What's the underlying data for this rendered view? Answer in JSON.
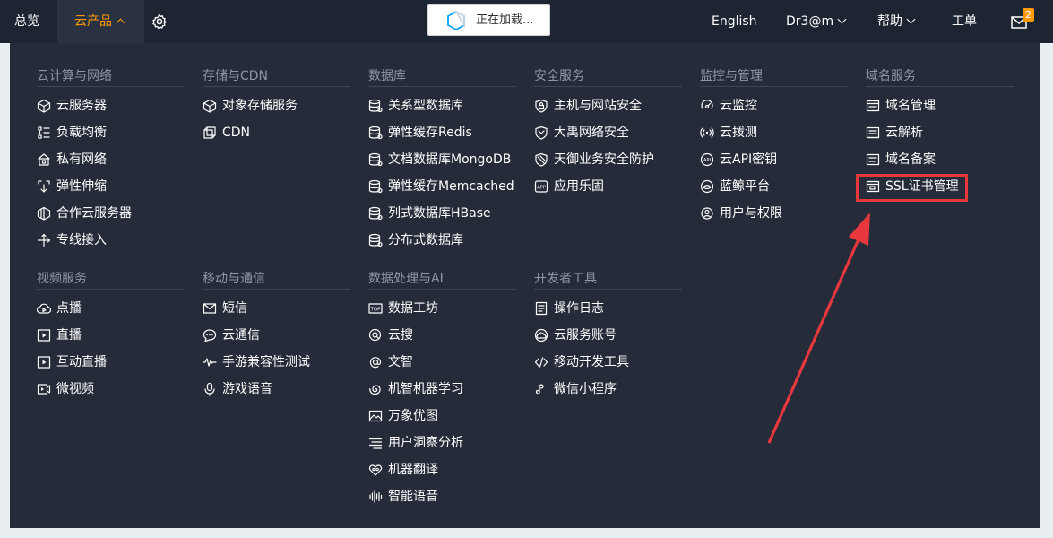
{
  "topbar": {
    "overview": "总览",
    "products": "云产品",
    "loading": "正在加载...",
    "language": "English",
    "user": "Dr3@m",
    "help": "帮助",
    "ticket": "工单",
    "mail_count": "2",
    "accent_color": "#ff9900",
    "bg_color": "#1e2532"
  },
  "menu": {
    "compute": {
      "title": "云计算与网络",
      "items": [
        {
          "label": "云服务器",
          "icon": "cube-icon"
        },
        {
          "label": "负载均衡",
          "icon": "load-balancer-icon"
        },
        {
          "label": "私有网络",
          "icon": "house-network-icon"
        },
        {
          "label": "弹性伸缩",
          "icon": "expand-icon"
        },
        {
          "label": "合作云服务器",
          "icon": "partner-cube-icon"
        },
        {
          "label": "专线接入",
          "icon": "direct-connect-icon"
        }
      ]
    },
    "storage": {
      "title": "存储与CDN",
      "items": [
        {
          "label": "对象存储服务",
          "icon": "cube-icon"
        },
        {
          "label": "CDN",
          "icon": "cdn-icon"
        }
      ]
    },
    "database": {
      "title": "数据库",
      "items": [
        {
          "label": "关系型数据库",
          "icon": "database-icon"
        },
        {
          "label": "弹性缓存Redis",
          "icon": "database-icon"
        },
        {
          "label": "文档数据库MongoDB",
          "icon": "database-icon"
        },
        {
          "label": "弹性缓存Memcached",
          "icon": "database-icon"
        },
        {
          "label": "列式数据库HBase",
          "icon": "database-icon"
        },
        {
          "label": "分布式数据库",
          "icon": "database-icon"
        }
      ]
    },
    "security": {
      "title": "安全服务",
      "items": [
        {
          "label": "主机与网站安全",
          "icon": "shield-lock-icon"
        },
        {
          "label": "大禹网络安全",
          "icon": "shield-icon"
        },
        {
          "label": "天御业务安全防护",
          "icon": "shield-striped-icon"
        },
        {
          "label": "应用乐固",
          "icon": "app-icon"
        }
      ]
    },
    "monitor": {
      "title": "监控与管理",
      "items": [
        {
          "label": "云监控",
          "icon": "monitor-icon"
        },
        {
          "label": "云拨测",
          "icon": "signal-icon"
        },
        {
          "label": "云API密钥",
          "icon": "api-key-icon"
        },
        {
          "label": "蓝鲸平台",
          "icon": "whale-icon"
        },
        {
          "label": "用户与权限",
          "icon": "user-icon"
        }
      ]
    },
    "domain": {
      "title": "域名服务",
      "items": [
        {
          "label": "域名管理",
          "icon": "domain-icon"
        },
        {
          "label": "云解析",
          "icon": "dns-icon"
        },
        {
          "label": "域名备案",
          "icon": "record-icon"
        },
        {
          "label": "SSL证书管理",
          "icon": "certificate-icon"
        }
      ]
    },
    "video": {
      "title": "视频服务",
      "items": [
        {
          "label": "点播",
          "icon": "cloud-play-icon"
        },
        {
          "label": "直播",
          "icon": "play-box-icon"
        },
        {
          "label": "互动直播",
          "icon": "play-box-icon"
        },
        {
          "label": "微视频",
          "icon": "video-icon"
        }
      ]
    },
    "mobile": {
      "title": "移动与通信",
      "items": [
        {
          "label": "短信",
          "icon": "envelope-icon"
        },
        {
          "label": "云通信",
          "icon": "chat-icon"
        },
        {
          "label": "手游兼容性测试",
          "icon": "waveform-icon"
        },
        {
          "label": "游戏语音",
          "icon": "microphone-icon"
        }
      ]
    },
    "ai": {
      "title": "数据处理与AI",
      "items": [
        {
          "label": "数据工坊",
          "icon": "top-icon"
        },
        {
          "label": "云搜",
          "icon": "search-icon"
        },
        {
          "label": "文智",
          "icon": "at-icon"
        },
        {
          "label": "机智机器学习",
          "icon": "spiral-icon"
        },
        {
          "label": "万象优图",
          "icon": "image-icon"
        },
        {
          "label": "用户洞察分析",
          "icon": "list-icon"
        },
        {
          "label": "机器翻译",
          "icon": "translate-icon"
        },
        {
          "label": "智能语音",
          "icon": "voice-icon"
        }
      ]
    },
    "dev": {
      "title": "开发者工具",
      "items": [
        {
          "label": "操作日志",
          "icon": "log-icon"
        },
        {
          "label": "云服务账号",
          "icon": "cloud-account-icon"
        },
        {
          "label": "移动开发工具",
          "icon": "code-icon"
        },
        {
          "label": "微信小程序",
          "icon": "mini-program-icon"
        }
      ]
    }
  },
  "annotation_color": "#e8383d"
}
